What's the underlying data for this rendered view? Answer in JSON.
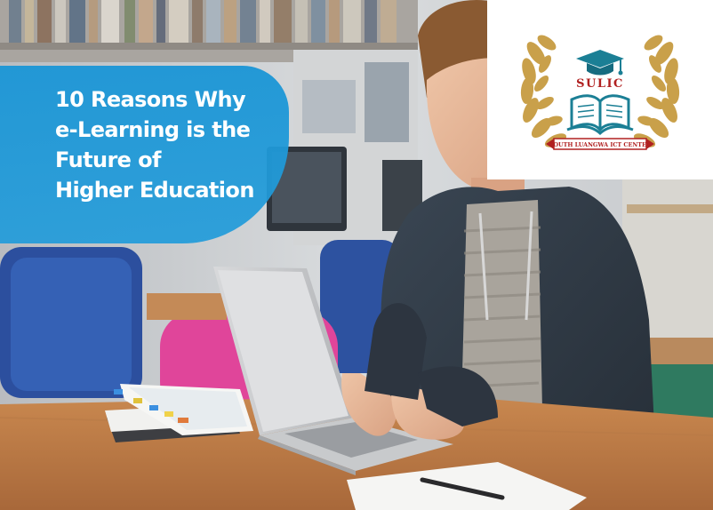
{
  "headline": {
    "lines": [
      "10 Reasons Why",
      "e-Learning is the",
      "Future of",
      "Higher Education"
    ]
  },
  "logo": {
    "acronym": "SULIC",
    "ribbon_text": "SOUTH LUANGWA ICT CENTER",
    "icons": [
      "laurel-wreath-icon",
      "graduation-cap-icon",
      "open-book-icon"
    ]
  },
  "colors": {
    "banner_blue": "#1c96d6",
    "logo_gold": "#c9a04a",
    "logo_teal": "#1b7f95",
    "logo_red": "#b02020"
  }
}
